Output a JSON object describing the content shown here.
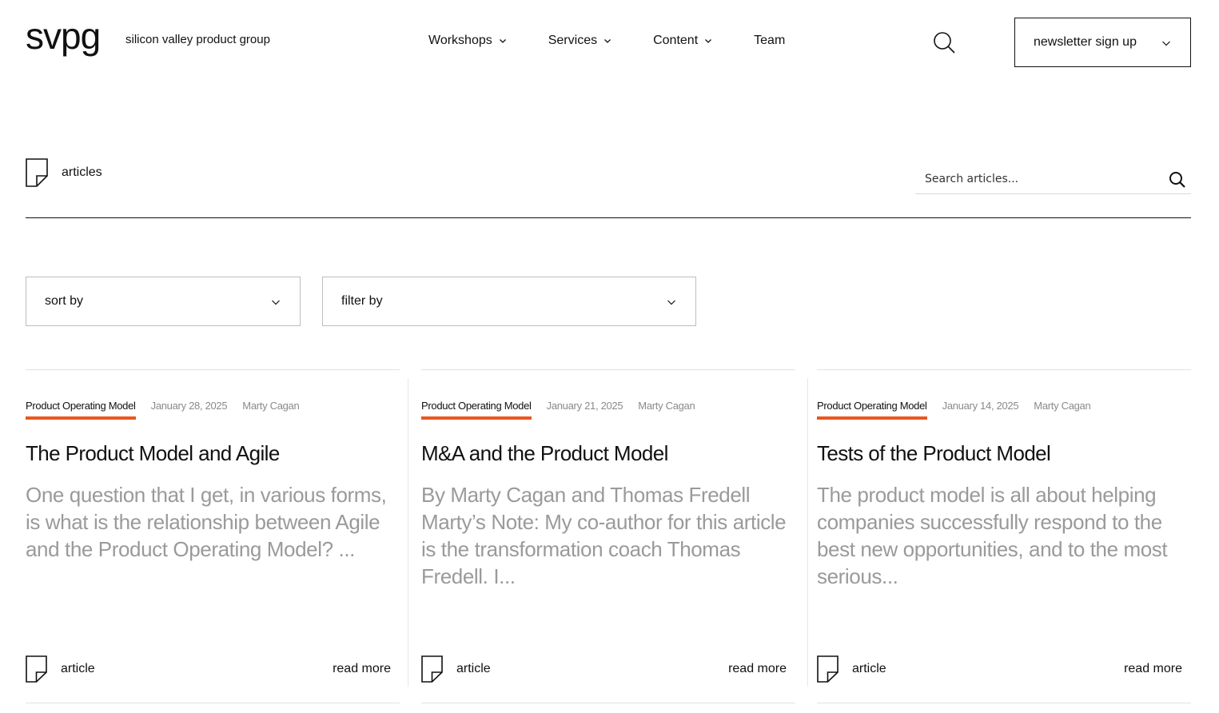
{
  "header": {
    "logo": "svpg",
    "tagline": "silicon valley product group",
    "nav": [
      {
        "label": "Workshops",
        "has_dropdown": true
      },
      {
        "label": "Services",
        "has_dropdown": true
      },
      {
        "label": "Content",
        "has_dropdown": true
      },
      {
        "label": "Team",
        "has_dropdown": false
      }
    ],
    "search_icon": "search-icon",
    "newsletter_label": "newsletter sign up"
  },
  "section": {
    "title": "articles",
    "icon": "document-icon",
    "search_placeholder": "Search articles..."
  },
  "controls": {
    "sort_label": "sort by",
    "filter_label": "filter by"
  },
  "colors": {
    "accent": "#e8571e",
    "muted_text": "#9a9a9a",
    "text": "#111111"
  },
  "cards": [
    {
      "tag": "Product Operating Model",
      "date": "January 28, 2025",
      "author": "Marty Cagan",
      "title": "The Product Model and Agile",
      "excerpt": "One question that I get, in various forms, is what is the relationship between Agile and the Product Operating Model?  ...",
      "type": "article",
      "read_more": "read more"
    },
    {
      "tag": "Product Operating Model",
      "date": "January 21, 2025",
      "author": "Marty Cagan",
      "title": "M&A and the Product Model",
      "excerpt": "By Marty Cagan and Thomas Fredell Marty’s Note: My co-author for this article is the transformation coach Thomas Fredell.  I...",
      "type": "article",
      "read_more": "read more"
    },
    {
      "tag": "Product Operating Model",
      "date": "January 14, 2025",
      "author": "Marty Cagan",
      "title": "Tests of the Product Model",
      "excerpt": "The product model is all about helping companies successfully respond to the best new opportunities, and to the most serious...",
      "type": "article",
      "read_more": "read more"
    }
  ]
}
